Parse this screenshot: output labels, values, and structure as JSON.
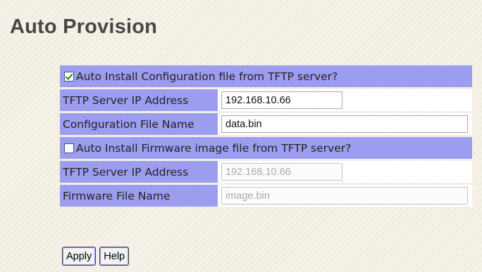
{
  "page": {
    "title": "Auto Provision"
  },
  "config_section": {
    "checkbox_label": "Auto Install Configuration file from TFTP server?",
    "checked": true,
    "server_ip_label": "TFTP Server IP Address",
    "server_ip_value": "192.168.10.66",
    "file_name_label": "Configuration File Name",
    "file_name_value": "data.bin"
  },
  "firmware_section": {
    "checkbox_label": "Auto Install Firmware image file from TFTP server?",
    "checked": false,
    "server_ip_label": "TFTP Server IP Address",
    "server_ip_value": "192.168.10.66",
    "file_name_label": "Firmware File Name",
    "file_name_value": "image.bin"
  },
  "buttons": {
    "apply": "Apply",
    "help": "Help"
  },
  "colors": {
    "row_bg": "#9d9df0",
    "page_bg": "#f6f1e7",
    "title": "#474747"
  }
}
